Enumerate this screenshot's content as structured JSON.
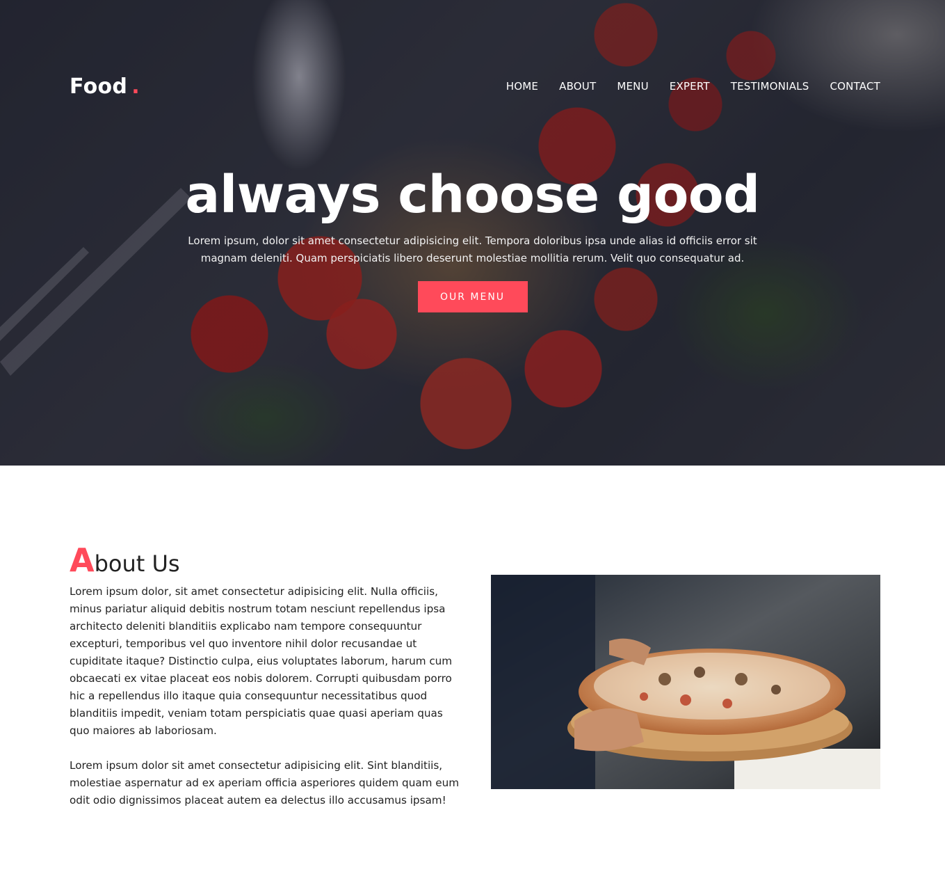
{
  "brand": {
    "name": "Food",
    "dot": ".",
    "accent_color": "#ff4a5a"
  },
  "nav": {
    "items": [
      {
        "label": "HOME"
      },
      {
        "label": "ABOUT"
      },
      {
        "label": "MENU"
      },
      {
        "label": "EXPERT"
      },
      {
        "label": "TESTIMONIALS"
      },
      {
        "label": "CONTACT"
      }
    ]
  },
  "hero": {
    "title": "always choose good",
    "text": "Lorem ipsum, dolor sit amet consectetur adipisicing elit. Tempora doloribus ipsa unde alias id officiis error sit magnam deleniti. Quam perspiciatis libero deserunt molestiae mollitia rerum. Velit quo consequatur ad.",
    "button": "OUR MENU",
    "background_image": "pasta-salad-photo"
  },
  "about": {
    "title_first_letter": "A",
    "title_rest": "bout Us",
    "paragraphs": [
      "Lorem ipsum dolor, sit amet consectetur adipisicing elit. Nulla officiis, minus pariatur aliquid debitis nostrum totam nesciunt repellendus ipsa architecto deleniti blanditiis explicabo nam tempore consequuntur excepturi, temporibus vel quo inventore nihil dolor recusandae ut cupiditate itaque? Distinctio culpa, eius voluptates laborum, harum cum obcaecati ex vitae placeat eos nobis dolorem. Corrupti quibusdam porro hic a repellendus illo itaque quia consequuntur necessitatibus quod blanditiis impedit, veniam totam perspiciatis quae quasi aperiam quas quo maiores ab laboriosam.",
      "Lorem ipsum dolor sit amet consectetur adipisicing elit. Sint blanditiis, molestiae aspernatur ad ex aperiam officia asperiores quidem quam eum odit odio dignissimos placeat autem ea delectus illo accusamus ipsam!"
    ],
    "image": "pizza-on-wooden-board-photo"
  }
}
